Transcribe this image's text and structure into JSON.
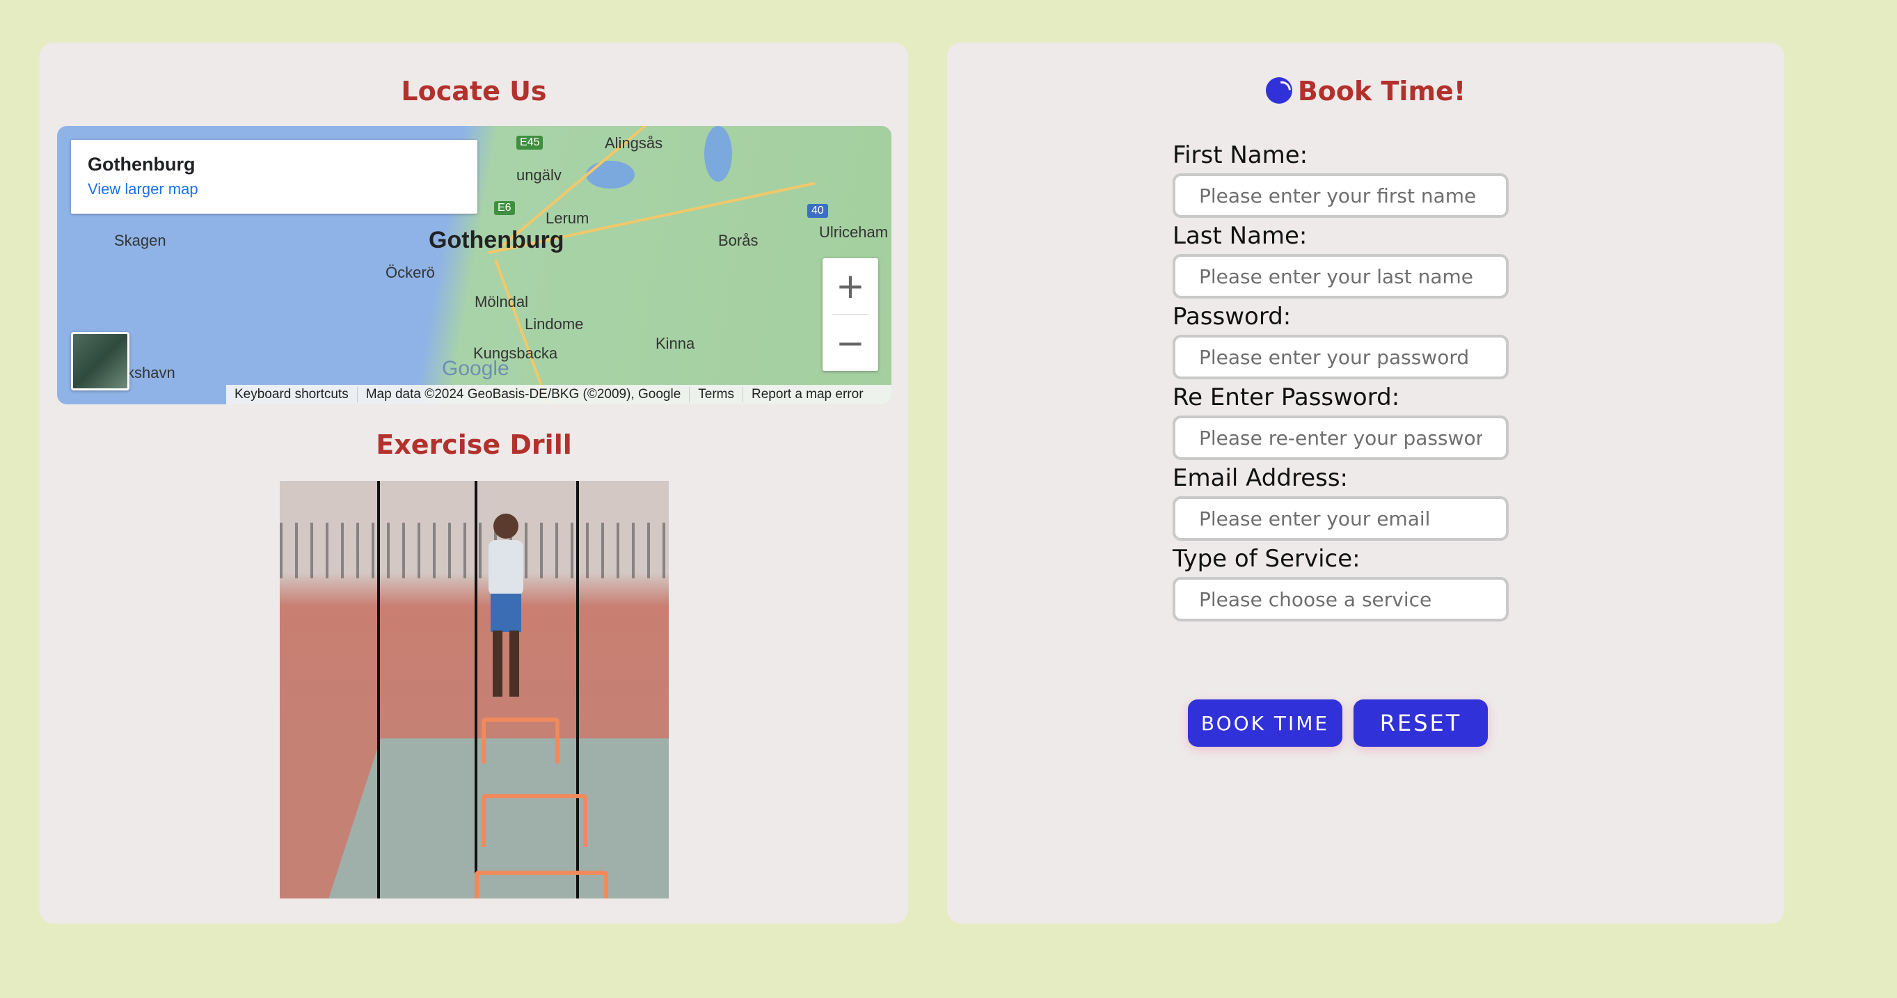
{
  "locate": {
    "title": "Locate Us",
    "map": {
      "place_name": "Gothenburg",
      "view_larger": "View larger map",
      "labels": {
        "gothenburg": "Gothenburg",
        "alingsas": "Alingsås",
        "kungalv": "ungälv",
        "lerum": "Lerum",
        "boras": "Borås",
        "ulricehamn": "Ulriceham",
        "skagen": "Skagen",
        "ockero": "Öckerö",
        "molndal": "Mölndal",
        "lindome": "Lindome",
        "kungsbacka": "Kungsbacka",
        "kinna": "Kinna",
        "frederikshavn": "kshavn"
      },
      "road_shields": {
        "e45": "E45",
        "e6": "E6",
        "r40": "40"
      },
      "zoom_in": "+",
      "zoom_out": "−",
      "google": "Google",
      "footer": {
        "shortcuts": "Keyboard shortcuts",
        "map_data": "Map data ©2024 GeoBasis-DE/BKG (©2009), Google",
        "terms": "Terms",
        "report": "Report a map error"
      }
    }
  },
  "drill": {
    "title": "Exercise Drill"
  },
  "booking": {
    "title": "Book Time!",
    "fields": [
      {
        "label": "First Name:",
        "placeholder": "Please enter your first name"
      },
      {
        "label": "Last Name:",
        "placeholder": "Please enter your last name"
      },
      {
        "label": "Password:",
        "placeholder": "Please enter your password"
      },
      {
        "label": "Re Enter Password:",
        "placeholder": "Please re-enter your password"
      },
      {
        "label": "Email Address:",
        "placeholder": "Please enter your email"
      },
      {
        "label": "Type of Service:",
        "placeholder": "Please choose a service"
      }
    ],
    "book_button": "BOOK TIME",
    "reset_button": "RESET"
  },
  "colors": {
    "background": "#e5ecc2",
    "card": "#eeeaea",
    "title": "#b3312c",
    "button": "#3131d9"
  }
}
